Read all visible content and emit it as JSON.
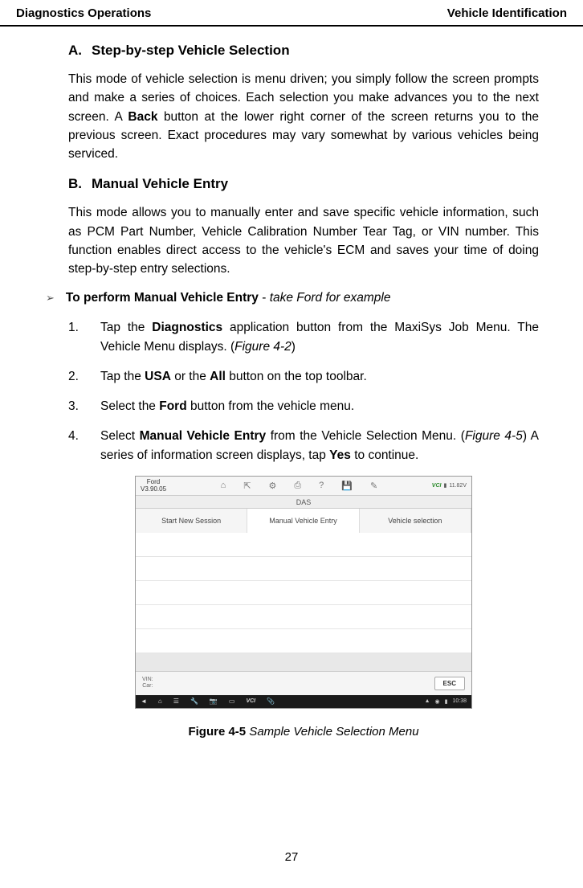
{
  "header": {
    "left": "Diagnostics Operations",
    "right": "Vehicle Identification"
  },
  "sectionA": {
    "letter": "A.",
    "title": "Step-by-step Vehicle Selection",
    "body_pre": "This mode of vehicle selection is menu driven; you simply follow the screen prompts and make a series of choices. Each selection you make advances you to the next screen. A ",
    "body_bold": "Back",
    "body_post": " button at the lower right corner of the screen returns you to the previous screen. Exact procedures may vary somewhat by various vehicles being serviced."
  },
  "sectionB": {
    "letter": "B.",
    "title": "Manual Vehicle Entry",
    "body": "This mode allows you to manually enter and save specific vehicle information, such as PCM Part Number, Vehicle Calibration Number Tear Tag, or VIN number. This function enables direct access to the vehicle's ECM and saves your time of doing step-by-step entry selections."
  },
  "subHeading": {
    "bold": "To perform Manual Vehicle Entry",
    "dash": " - ",
    "italic": "take Ford for example"
  },
  "steps": [
    {
      "num": "1.",
      "pre": "Tap the ",
      "b1": "Diagnostics",
      "mid": " application button from the MaxiSys Job Menu. The Vehicle Menu displays. (",
      "i1": "Figure 4-2",
      "post": ")"
    },
    {
      "num": "2.",
      "pre": "Tap the ",
      "b1": "USA",
      "mid": " or the ",
      "b2": "All",
      "post": " button on the top toolbar."
    },
    {
      "num": "3.",
      "pre": "Select the ",
      "b1": "Ford",
      "post": " button from the vehicle menu."
    },
    {
      "num": "4.",
      "pre": "Select ",
      "b1": "Manual Vehicle Entry",
      "mid": " from the Vehicle Selection Menu. (",
      "i1": "Figure 4-5",
      "mid2": ") A series of information screen displays, tap ",
      "b2": "Yes",
      "post": " to continue."
    }
  ],
  "screenshot": {
    "version": "Ford\nV3.90.05",
    "voltage": "11.82V",
    "vci": "VCI",
    "das": "DAS",
    "tabs": [
      "Start New Session",
      "Manual Vehicle Entry",
      "Vehicle selection"
    ],
    "footerVin": "VIN:",
    "footerCar": "Car:",
    "esc": "ESC",
    "navVci": "VCI",
    "navTime": "10:38"
  },
  "figureCaption": {
    "bold": "Figure 4-5",
    "italic": " Sample Vehicle Selection Menu"
  },
  "pageNum": "27"
}
